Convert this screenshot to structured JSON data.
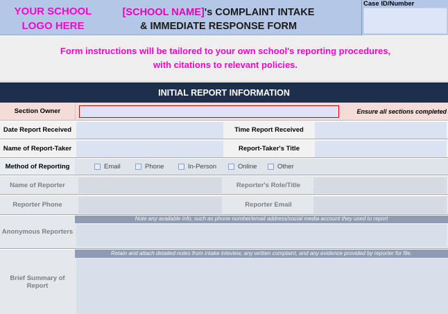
{
  "header": {
    "logo_line1": "YOUR SCHOOL",
    "logo_line2": "LOGO HERE",
    "title_school": "[SCHOOL NAME]",
    "title_rest": "'s COMPLAINT INTAKE",
    "title_line2": "& IMMEDIATE RESPONSE FORM",
    "case_label": "Case ID/Number"
  },
  "instructions": {
    "line1": "Form instructions will be tailored to your own school's reporting procedures,",
    "line2": "with citations to relevant policies."
  },
  "section": {
    "title": "INITIAL REPORT INFORMATION",
    "owner_label": "Section Owner",
    "owner_note": "Ensure all sections completed"
  },
  "fields": {
    "date_received": "Date Report Received",
    "time_received": "Time Report Received",
    "report_taker": "Name of Report-Taker",
    "report_taker_title": "Report-Taker's Title",
    "method": "Method of Reporting",
    "reporter_name": "Name of Reporter",
    "reporter_role": "Reporter's Role/Title",
    "reporter_phone": "Reporter Phone",
    "reporter_email": "Reporter Email",
    "anonymous": "Anonymous Reporters",
    "summary_line1": "Brief Summary of",
    "summary_line2": "Report"
  },
  "methods": [
    "Email",
    "Phone",
    "In-Person",
    "Online",
    "Other"
  ],
  "notes": {
    "anonymous": "Note any available info, such as phone number/email address/social media account they used to report",
    "summary": "Retain and attach detailed notes from intake inteview, any written complaint, and any evidence provided by reporter for file."
  },
  "colors": {
    "accent_pink": "#ff00cc",
    "header_blue": "#b4c7e7",
    "section_navy": "#1e2f4d",
    "input_blue": "#dbe3f3"
  }
}
